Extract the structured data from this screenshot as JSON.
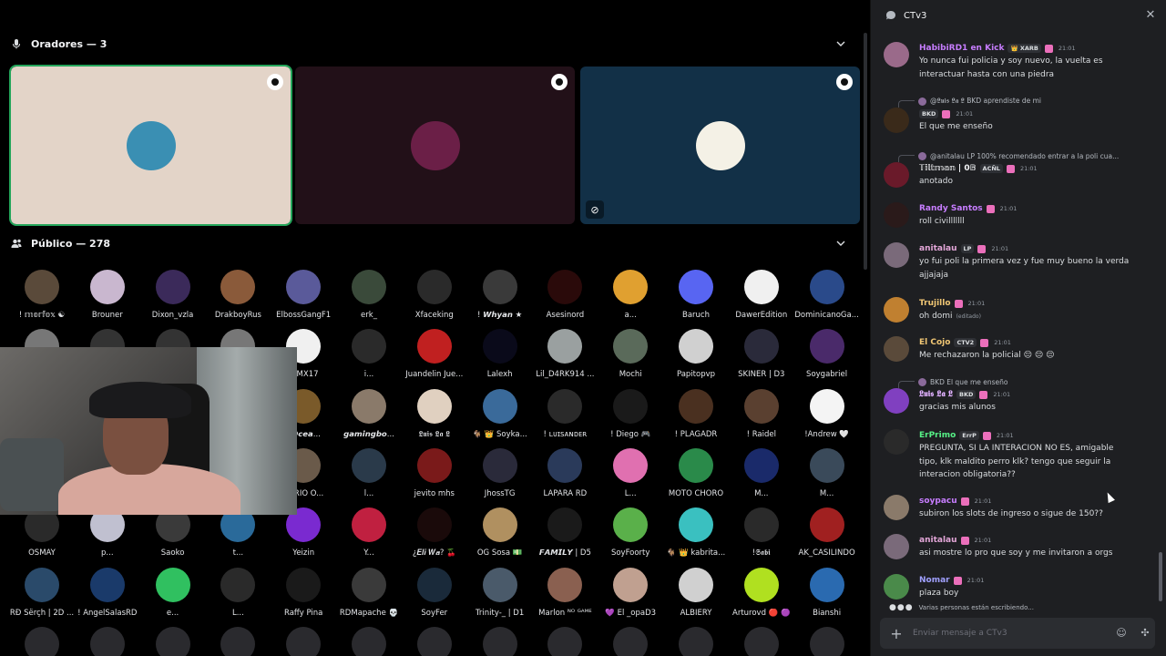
{
  "stage": {
    "speakers_label": "Oradores — 3",
    "public_label": "Público — 278",
    "speakers": [
      {
        "bg": "#e3d4c8",
        "avatar": "#3a8fb3",
        "moderator": true,
        "muted": false
      },
      {
        "bg": "#221018",
        "avatar": "#6b1f47",
        "moderator": true,
        "muted": false
      },
      {
        "bg": "#123047",
        "avatar": "#f4f1e6",
        "moderator": true,
        "muted": true
      }
    ],
    "audience": [
      [
        "! 𝕞𝕠𝕣𝕗𝕠𝕩 ☯",
        "#5a4a3a"
      ],
      [
        "Brouner",
        "#c9b7cf"
      ],
      [
        "Dixon_vzla",
        "#3b2a5a"
      ],
      [
        "DrakboyRus",
        "#8a5a3a"
      ],
      [
        "ElbossGangF1",
        "#5a5a9a"
      ],
      [
        "erk_",
        "#3a4a3a"
      ],
      [
        "Xfaceking",
        "#2a2a2a"
      ],
      [
        "! 𝙒𝙝𝙮𝙖𝙣 ★",
        "#3a3a3a"
      ],
      [
        "Asesinord",
        "#2a0a0a"
      ],
      [
        "a...",
        "#e0a030"
      ],
      [
        "Baruch",
        "#5865f2"
      ],
      [
        "DawerEdition",
        "#f0f0f0"
      ],
      [
        "DominicanoGa...",
        "#2a4a8a"
      ],
      [
        "",
        "#777"
      ],
      [
        "",
        "#333"
      ],
      [
        "",
        "#333"
      ],
      [
        "",
        "#777"
      ],
      [
        "erMX17",
        "#f0f0f0"
      ],
      [
        "i...",
        "#2a2a2a"
      ],
      [
        "Juandelin Jue...",
        "#c02020"
      ],
      [
        "Lalexh",
        "#0a0a1a"
      ],
      [
        "Lil_D4RK914 ...",
        "#9aa0a0"
      ],
      [
        "Mochi",
        "#5a6a5a"
      ],
      [
        "Papitopvp",
        "#d0d0d0"
      ],
      [
        "SKINER | D3",
        "#2a2a3a"
      ],
      [
        "Soygabriel",
        "#4a2a6a"
      ],
      [
        "",
        "#333"
      ],
      [
        "",
        "#333"
      ],
      [
        "",
        "#333"
      ],
      [
        "",
        "#333"
      ],
      [
        "𝙮𝙊𝙘𝙚𝙖...",
        "#7a5a2a"
      ],
      [
        "𝙜𝙖𝙢𝙞𝙣𝙜𝙗𝙤...",
        "#8a7a6a"
      ],
      [
        "𝕷𝖚𝖎𝖘 𝕷𝖆 𝕷",
        "#e0d0c0"
      ],
      [
        "🐐 👑 Soyka...",
        "#3a6a9a"
      ],
      [
        "! ʟᴜɪꜱᴀɴᴅᴇʀ",
        "#2a2a2a"
      ],
      [
        "! Diego 🎮",
        "#1a1a1a"
      ],
      [
        "! PLAGADR",
        "#4a3020"
      ],
      [
        "! Raidel",
        "#5a4030"
      ],
      [
        "!Andrew 🤍",
        "#f4f4f4"
      ],
      [
        "",
        "#333"
      ],
      [
        "",
        "#333"
      ],
      [
        "",
        "#333"
      ],
      [
        "",
        "#333"
      ],
      [
        "CARIO O...",
        "#6a5a4a"
      ],
      [
        "l...",
        "#2a3a4a"
      ],
      [
        "jevito mhs",
        "#7a1a1a"
      ],
      [
        "JhossTG",
        "#2a2a3a"
      ],
      [
        "LAPARA RD",
        "#2a3a5a"
      ],
      [
        "L...",
        "#e070b0"
      ],
      [
        "MOTO CHORO",
        "#2a8a4a"
      ],
      [
        "M...",
        "#1a2a6a"
      ],
      [
        "M...",
        "#3a4a5a"
      ],
      [
        "OSMAY",
        "#2a2a2a"
      ],
      [
        "p...",
        "#c0c0d0"
      ],
      [
        "Saoko",
        "#3a3a3a"
      ],
      [
        "t...",
        "#2a6a9a"
      ],
      [
        "Yeizin",
        "#7a2ad0"
      ],
      [
        "Y...",
        "#c02040"
      ],
      [
        "¿𝑬𝒍𝒊 𝑾𝒂? 🍒",
        "#1a0a0a"
      ],
      [
        "OG Sosa 💵",
        "#b09060"
      ],
      [
        "𝙁𝘼𝙈𝙄𝙇𝙔 | D5",
        "#1a1a1a"
      ],
      [
        "SoyFoorty",
        "#5ab04a"
      ],
      [
        "🐐 👑 kabrita...",
        "#3ac0c0"
      ],
      [
        "!𝕾𝖆𝖇𝖎",
        "#2a2a2a"
      ],
      [
        "AK_CASILINDO",
        "#a02020"
      ],
      [
        "RÐ Šërçh | 2D ...",
        "#2a4a6a"
      ],
      [
        "! AngelSalasRD",
        "#1a3a6a"
      ],
      [
        "e...",
        "#30c060"
      ],
      [
        "L...",
        "#2a2a2a"
      ],
      [
        "Raffy Pina",
        "#1a1a1a"
      ],
      [
        "RDMapache 💀",
        "#3a3a3a"
      ],
      [
        "SoyFer",
        "#1a2a3a"
      ],
      [
        "Trinity-_ | D1",
        "#4a5a6a"
      ],
      [
        "Marlon ᴺᴼ ᴳᴬᴹᴱ",
        "#8a6050"
      ],
      [
        "💜 El _opaD3",
        "#c0a090"
      ],
      [
        "ALBIERY",
        "#d0d0d0"
      ],
      [
        "Arturovd 🔴 🟣",
        "#b0e020"
      ],
      [
        "Bianshi",
        "#2a6ab0"
      ]
    ]
  },
  "chat": {
    "channel": "CTv3",
    "placeholder": "Enviar mensaje a CTv3",
    "typing": "Varias personas están escribiendo...",
    "messages": [
      {
        "author": "HabibiRD1 en Kick",
        "color": "#c77dff",
        "av": "#9a6a8a",
        "tags": "👑 XARB",
        "time": "21:01",
        "lines": [
          "Yo nunca fui policia y soy nuevo, la vuelta es",
          "interactuar hasta con una piedra"
        ]
      },
      {
        "reply": "@𝕷𝖚𝖎𝖘 𝕷𝖆 𝕷 BKD aprendiste de mi",
        "author": "",
        "color": "#dbdee1",
        "av": "#3a2a1a",
        "tags": "BKD",
        "time": "21:01",
        "lines": [
          "El que me enseño"
        ]
      },
      {
        "reply": "@anitalau LP 100% recomendado entrar a la poli cua...",
        "author": "𝕋𝕚𝕝𝕥𝕞𝕒𝕟 | 0𝔹",
        "color": "#f2f3f5",
        "av": "#6a1a2a",
        "tags": "ACÑL",
        "time": "21:01",
        "lines": [
          "anotado"
        ]
      },
      {
        "author": "Randy Santos",
        "color": "#c77dff",
        "av": "#2a1a1a",
        "tags": "",
        "time": "21:01",
        "lines": [
          "roll civilllllll"
        ]
      },
      {
        "author": "anitalau",
        "color": "#e3a6d8",
        "av": "#7a6a7a",
        "tags": "LP",
        "time": "21:01",
        "lines": [
          "yo fui poli la primera vez y fue muy bueno la verda",
          "ajjajaja"
        ]
      },
      {
        "author": "Trujillo",
        "color": "#f0c674",
        "av": "#c08030",
        "tags": "",
        "time": "21:01",
        "lines": [
          "oh domi"
        ],
        "edited": "(editado)"
      },
      {
        "author": "El Cojo",
        "color": "#f0c674",
        "av": "#5a4a3a",
        "tags": "CTV2",
        "time": "21:01",
        "lines": [
          "Me rechazaron la policial 😔 😔 😔"
        ]
      },
      {
        "reply": "BKD El que me enseño",
        "author": "𝕷𝖚𝖎𝖘 𝕷𝖆 𝕷",
        "color": "#e0b0ff",
        "av": "#8040c0",
        "tags": "BKD",
        "time": "21:01",
        "lines": [
          "gracias mis alunos"
        ]
      },
      {
        "author": "ErPrimo",
        "color": "#57f287",
        "av": "#2a2a2a",
        "tags": "ErrP",
        "time": "21:01",
        "lines": [
          "PREGUNTA, SI LA INTERACION NO ES, amigable",
          "tipo, klk  maldito perro klk? tengo que seguir la",
          "interacion obligatoria??"
        ]
      },
      {
        "author": "soypacu",
        "color": "#c77dff",
        "av": "#8a7a6a",
        "tags": "",
        "time": "21:01",
        "lines": [
          "subiron los slots de ingreso o sigue de 150??"
        ]
      },
      {
        "author": "anitalau",
        "color": "#e3a6d8",
        "av": "#7a6a7a",
        "tags": "",
        "time": "21:01",
        "lines": [
          "asi mostre lo pro que soy y me invitaron a orgs"
        ]
      },
      {
        "author": "Nomar",
        "color": "#a0a0ff",
        "av": "#4a8a4a",
        "tags": "",
        "time": "21:01",
        "lines": [
          "plaza boy"
        ]
      }
    ]
  }
}
